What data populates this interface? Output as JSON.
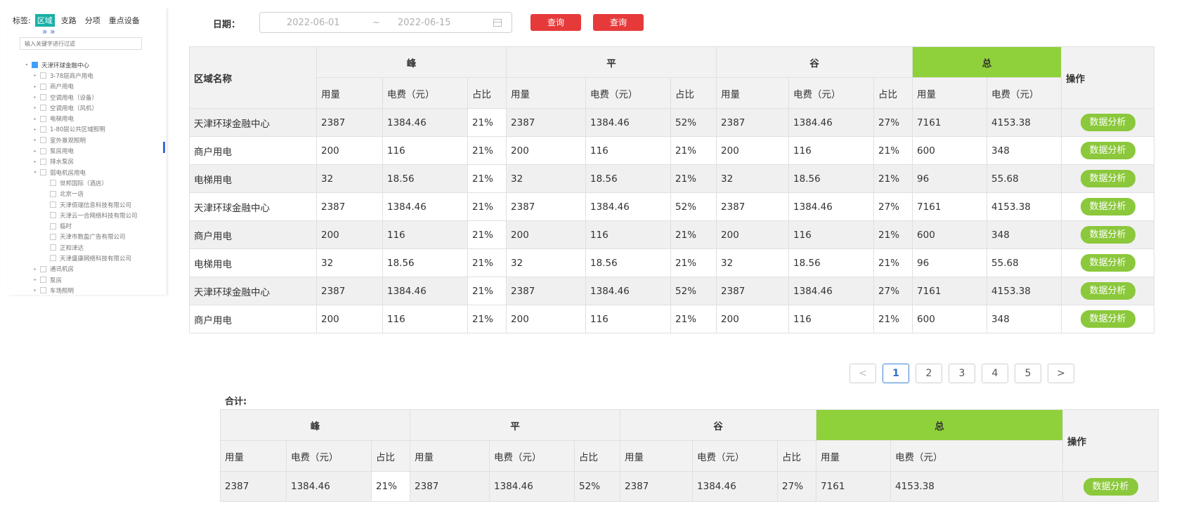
{
  "sidebar": {
    "tabs_label": "标签:",
    "tabs": [
      "区域",
      "支路",
      "分项",
      "重点设备"
    ],
    "chevrons": "» »",
    "search_placeholder": "输入关键字进行过滤",
    "tree": [
      {
        "label": "天津环球金融中心",
        "level": 0,
        "arrow": "▾",
        "checked": true
      },
      {
        "label": "3-78层商户用电",
        "level": 1,
        "arrow": "▸"
      },
      {
        "label": "商户用电",
        "level": 1,
        "arrow": "▸"
      },
      {
        "label": "空调用电（设备）",
        "level": 1,
        "arrow": "▸"
      },
      {
        "label": "空调用电（风机）",
        "level": 1,
        "arrow": "▸"
      },
      {
        "label": "电梯用电",
        "level": 1,
        "arrow": "▸"
      },
      {
        "label": "1-80层公共区域照明",
        "level": 1,
        "arrow": "▸"
      },
      {
        "label": "室外景观照明",
        "level": 1,
        "arrow": "▸"
      },
      {
        "label": "泵房用电",
        "level": 1,
        "arrow": "▸"
      },
      {
        "label": "排水泵房",
        "level": 1,
        "arrow": "▸"
      },
      {
        "label": "弱电机房用电",
        "level": 1,
        "arrow": "▾"
      },
      {
        "label": "世邦国际（酒店）",
        "level": 2,
        "arrow": ""
      },
      {
        "label": "北京一店",
        "level": 2,
        "arrow": ""
      },
      {
        "label": "天津佰瑞信息科技有限公司",
        "level": 2,
        "arrow": ""
      },
      {
        "label": "天津云一合网络科技有限公司",
        "level": 2,
        "arrow": ""
      },
      {
        "label": "临时",
        "level": 2,
        "arrow": ""
      },
      {
        "label": "天津市数盈广告有限公司",
        "level": 2,
        "arrow": ""
      },
      {
        "label": "正和津达",
        "level": 2,
        "arrow": ""
      },
      {
        "label": "天津盛康网络科技有限公司",
        "level": 2,
        "arrow": ""
      },
      {
        "label": "通讯机房",
        "level": 1,
        "arrow": "▸"
      },
      {
        "label": "泵房",
        "level": 1,
        "arrow": "▸"
      },
      {
        "label": "车场照明",
        "level": 1,
        "arrow": "▸"
      }
    ]
  },
  "filter": {
    "date_label": "日期：",
    "start_date": "2022-06-01",
    "separator": "~",
    "end_date": "2022-06-15",
    "query_button_1": "查询",
    "query_button_2": "查询"
  },
  "main_table": {
    "col_region": "区域名称",
    "groups": [
      "峰",
      "平",
      "谷",
      "总"
    ],
    "col_ops": "操作",
    "sub_usage": "用量",
    "sub_fee": "电费（元）",
    "sub_ratio": "占比",
    "rows": [
      {
        "name": "天津环球金融中心",
        "c": [
          "2387",
          "1384.46",
          "21%",
          "2387",
          "1384.46",
          "52%",
          "2387",
          "1384.46",
          "27%",
          "7161",
          "4153.38"
        ],
        "action": "数据分析"
      },
      {
        "name": "商户用电",
        "c": [
          "200",
          "116",
          "21%",
          "200",
          "116",
          "21%",
          "200",
          "116",
          "21%",
          "600",
          "348"
        ],
        "action": "数据分析"
      },
      {
        "name": "电梯用电",
        "c": [
          "32",
          "18.56",
          "21%",
          "32",
          "18.56",
          "21%",
          "32",
          "18.56",
          "21%",
          "96",
          "55.68"
        ],
        "action": "数据分析"
      },
      {
        "name": "天津环球金融中心",
        "c": [
          "2387",
          "1384.46",
          "21%",
          "2387",
          "1384.46",
          "52%",
          "2387",
          "1384.46",
          "27%",
          "7161",
          "4153.38"
        ],
        "action": "数据分析"
      },
      {
        "name": "商户用电",
        "c": [
          "200",
          "116",
          "21%",
          "200",
          "116",
          "21%",
          "200",
          "116",
          "21%",
          "600",
          "348"
        ],
        "action": "数据分析"
      },
      {
        "name": "电梯用电",
        "c": [
          "32",
          "18.56",
          "21%",
          "32",
          "18.56",
          "21%",
          "32",
          "18.56",
          "21%",
          "96",
          "55.68"
        ],
        "action": "数据分析"
      },
      {
        "name": "天津环球金融中心",
        "c": [
          "2387",
          "1384.46",
          "21%",
          "2387",
          "1384.46",
          "52%",
          "2387",
          "1384.46",
          "27%",
          "7161",
          "4153.38"
        ],
        "action": "数据分析"
      },
      {
        "name": "商户用电",
        "c": [
          "200",
          "116",
          "21%",
          "200",
          "116",
          "21%",
          "200",
          "116",
          "21%",
          "600",
          "348"
        ],
        "action": "数据分析"
      }
    ]
  },
  "pagination": {
    "prev": "<",
    "pages": [
      "1",
      "2",
      "3",
      "4",
      "5"
    ],
    "current": "1",
    "next": ">"
  },
  "summary": {
    "label": "合计:",
    "groups": [
      "峰",
      "平",
      "谷",
      "总"
    ],
    "col_ops": "操作",
    "sub_usage": "用量",
    "sub_fee": "电费（元）",
    "sub_ratio": "占比",
    "row": [
      "2387",
      "1384.46",
      "21%",
      "2387",
      "1384.46",
      "52%",
      "2387",
      "1384.46",
      "27%",
      "7161",
      "4153.38"
    ],
    "action": "数据分析"
  },
  "colors": {
    "accent_red": "#e63a3a",
    "total_green": "#8fd13a",
    "pill_green": "#8bc83b",
    "active_tab_teal": "#18b0a6"
  }
}
